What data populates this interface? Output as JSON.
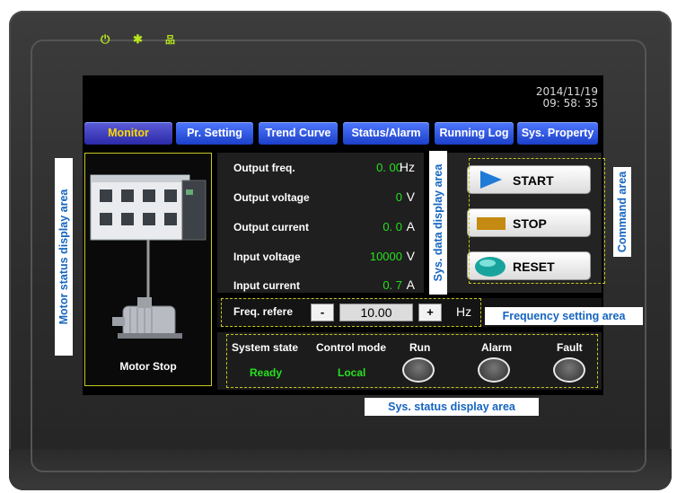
{
  "datetime": {
    "date": "2014/11/19",
    "time": "09: 58: 35"
  },
  "indicators": [
    {
      "icon": "power-icon",
      "glyph": "⏻"
    },
    {
      "icon": "run-indicator-icon",
      "glyph": "✱"
    },
    {
      "icon": "network-icon",
      "glyph": "品"
    }
  ],
  "tabs": [
    {
      "label": "Monitor",
      "active": true
    },
    {
      "label": "Pr. Setting"
    },
    {
      "label": "Trend Curve"
    },
    {
      "label": "Status/Alarm"
    },
    {
      "label": "Running Log"
    },
    {
      "label": "Sys. Property"
    }
  ],
  "motor": {
    "status_label": "Motor Stop"
  },
  "data_rows": [
    {
      "label": "Output freq.",
      "value": "0. 00",
      "unit": "Hz"
    },
    {
      "label": "Output voltage",
      "value": "0",
      "unit": "V"
    },
    {
      "label": "Output current",
      "value": "0. 0",
      "unit": "A"
    },
    {
      "label": "Input voltage",
      "value": "10000",
      "unit": "V"
    },
    {
      "label": "Input current",
      "value": "0. 7",
      "unit": "A"
    }
  ],
  "commands": {
    "start": "START",
    "stop": "STOP",
    "reset": "RESET"
  },
  "frequency": {
    "label": "Freq. refere",
    "minus": "-",
    "value": "10.00",
    "plus": "+",
    "unit": "Hz"
  },
  "status": {
    "system_state_label": "System state",
    "system_state_value": "Ready",
    "control_mode_label": "Control mode",
    "control_mode_value": "Local",
    "run_label": "Run",
    "alarm_label": "Alarm",
    "fault_label": "Fault"
  },
  "annotations": {
    "motor_area": "Motor status display area",
    "data_area": "Sys. data display area",
    "command_area": "Command area",
    "freq_area": "Frequency setting area",
    "status_area": "Sys. status display area"
  },
  "colors": {
    "accent_green": "#27e020",
    "tab_blue": "#1b3fc8",
    "highlight_yellow": "#c8c820",
    "callout_blue": "#1565c0"
  }
}
